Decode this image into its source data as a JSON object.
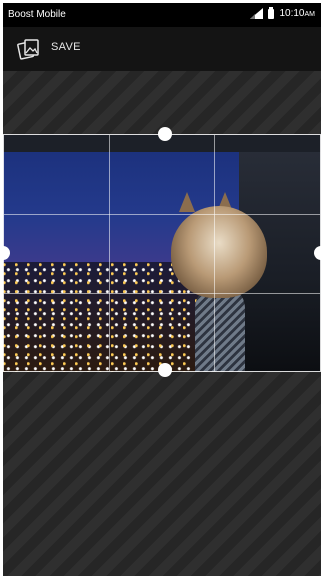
{
  "status_bar": {
    "carrier": "Boost Mobile",
    "time": "10:10",
    "time_suffix": "AM",
    "icons": [
      "signal-icon",
      "battery-icon"
    ]
  },
  "app_bar": {
    "icon": "gallery-icon",
    "save_label": "SAVE"
  },
  "editor": {
    "mode": "crop",
    "grid": "3x3",
    "handles": [
      "top",
      "bottom",
      "left",
      "right"
    ]
  },
  "colors": {
    "background": "#2a2a2a",
    "app_bar": "#141414",
    "handle": "#ffffff"
  }
}
